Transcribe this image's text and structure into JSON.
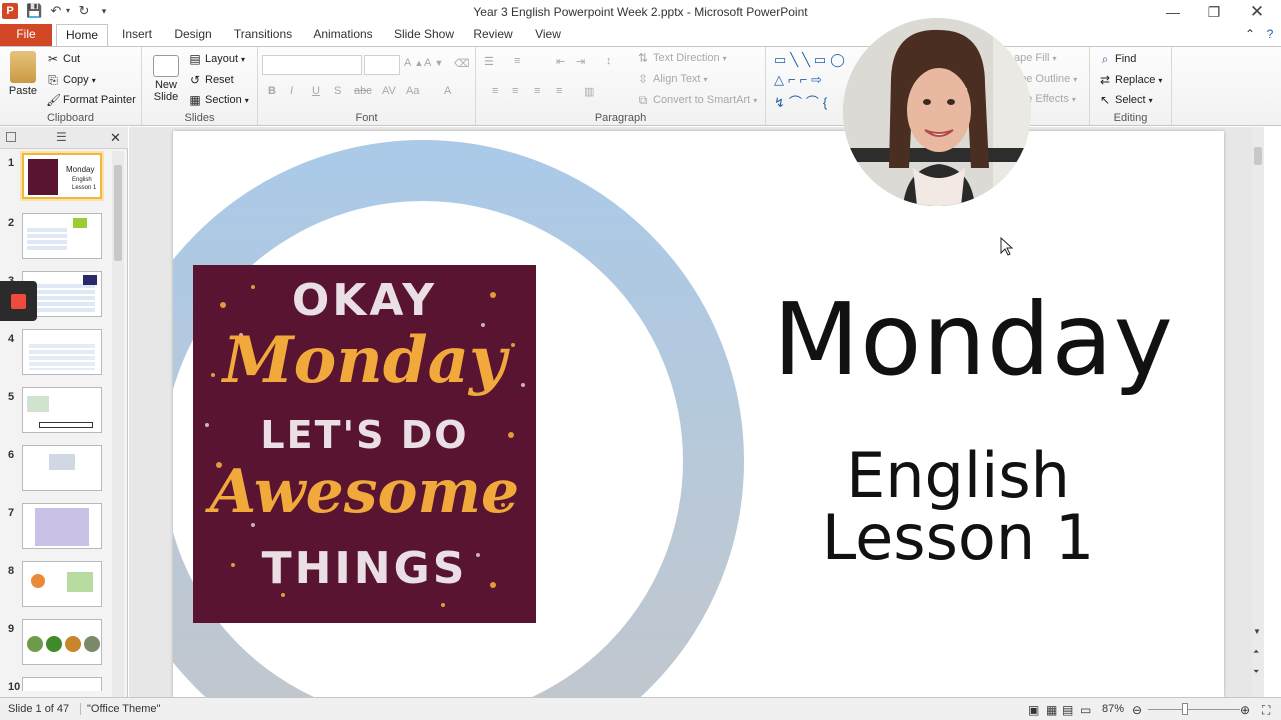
{
  "window": {
    "title": "Year 3 English Powerpoint Week 2.pptx  -  Microsoft PowerPoint",
    "app_icon_letter": "P"
  },
  "tabs": [
    {
      "label": "File"
    },
    {
      "label": "Home"
    },
    {
      "label": "Insert"
    },
    {
      "label": "Design"
    },
    {
      "label": "Transitions"
    },
    {
      "label": "Animations"
    },
    {
      "label": "Slide Show"
    },
    {
      "label": "Review"
    },
    {
      "label": "View"
    }
  ],
  "ribbon": {
    "clipboard": {
      "label": "Clipboard",
      "paste": "Paste",
      "cut": "Cut",
      "copy": "Copy",
      "format_painter": "Format Painter"
    },
    "slides": {
      "label": "Slides",
      "new_slide": "New Slide",
      "layout": "Layout",
      "reset": "Reset",
      "section": "Section"
    },
    "font": {
      "label": "Font"
    },
    "paragraph": {
      "label": "Paragraph",
      "text_direction": "Text Direction",
      "align_text": "Align Text",
      "convert_smartart": "Convert to SmartArt"
    },
    "drawing": {
      "shape_fill": "ape Fill",
      "shape_outline": "ape Outline",
      "shape_effects": "ape Effects"
    },
    "editing": {
      "label": "Editing",
      "find": "Find",
      "replace": "Replace",
      "select": "Select"
    }
  },
  "thumbnails": [
    {
      "num": "1",
      "selected": true
    },
    {
      "num": "2"
    },
    {
      "num": "3"
    },
    {
      "num": "4"
    },
    {
      "num": "5"
    },
    {
      "num": "6"
    },
    {
      "num": "7"
    },
    {
      "num": "8"
    },
    {
      "num": "9"
    },
    {
      "num": "10"
    }
  ],
  "slide": {
    "poster_lines": [
      "OKAY",
      "Monday",
      "LET'S DO",
      "Awesome",
      "THINGS"
    ],
    "title": "Monday",
    "subtitle_line1": "English",
    "subtitle_line2": "Lesson 1"
  },
  "thumb1": {
    "title": "Monday",
    "line1": "English",
    "line2": "Lesson 1"
  },
  "status": {
    "slide_info": "Slide 1 of 47",
    "theme": "\"Office Theme\"",
    "zoom": "87%"
  },
  "colors": {
    "file_tab": "#d24726",
    "poster_bg": "#581431",
    "poster_orange": "#f2a93b",
    "brush_blue": "#9cc0e3",
    "thumb_selected": "#f0b640"
  }
}
